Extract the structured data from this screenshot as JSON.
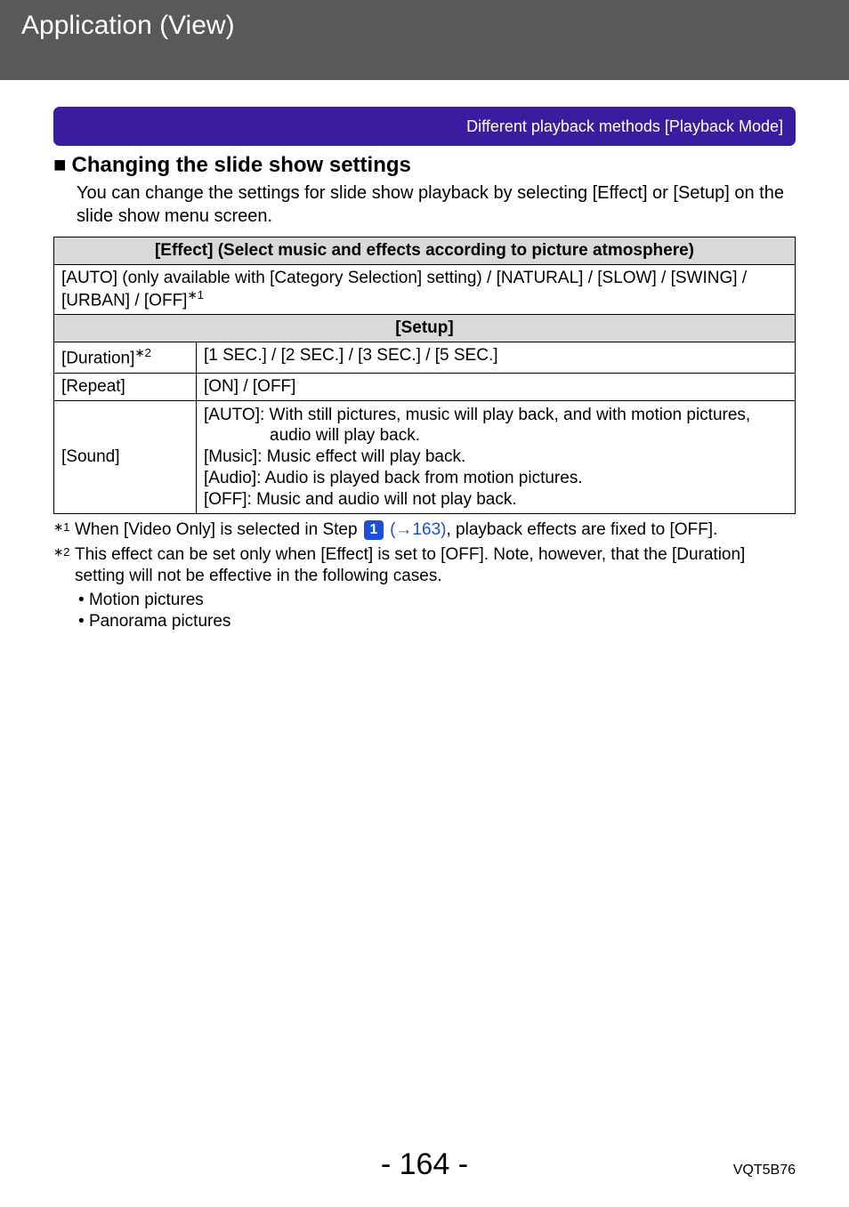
{
  "header": {
    "title": "Application (View)"
  },
  "banner": {
    "text": "Different playback methods  [Playback Mode]"
  },
  "section": {
    "bullet": "■",
    "heading": "Changing the slide show settings",
    "intro": "You can change the settings for slide show playback by selecting [Effect] or [Setup] on the slide show menu screen."
  },
  "table": {
    "effect_header": "[Effect] (Select music and effects according to picture atmosphere)",
    "effect_row_pre": "[AUTO] (only available with [Category Selection] setting) / [NATURAL] / [SLOW] / [SWING] / [URBAN] / [OFF]",
    "effect_row_sup": "1",
    "setup_header": "[Setup]",
    "duration_label_pre": "[Duration]",
    "duration_sup": "2",
    "duration_value": "[1 SEC.] / [2 SEC.] / [3 SEC.] / [5 SEC.]",
    "repeat_label": "[Repeat]",
    "repeat_value": "[ON] / [OFF]",
    "sound_label": "[Sound]",
    "sound_auto_line1": "[AUTO]: With still pictures, music will play back, and with motion pictures,",
    "sound_auto_line2": "audio will play back.",
    "sound_music": "[Music]: Music effect will play back.",
    "sound_audio": "[Audio]: Audio is played back from motion pictures.",
    "sound_off": "[OFF]: Music and audio will not play back."
  },
  "footnotes": {
    "fn1_marker_sup": "1",
    "fn1_pre": "When [Video Only] is selected in Step ",
    "fn1_step": "1",
    "fn1_link": "(→163)",
    "fn1_post": ", playback effects are fixed to [OFF].",
    "fn2_marker_sup": "2",
    "fn2_body": "This effect can be set only when [Effect] is set to [OFF]. Note, however, that the [Duration] setting will not be effective in the following cases.",
    "bullets": {
      "b1": "Motion pictures",
      "b2": "Panorama pictures"
    }
  },
  "footer": {
    "page_prefix": "- ",
    "page_number": "164",
    "page_suffix": " -",
    "doc_code": "VQT5B76"
  }
}
